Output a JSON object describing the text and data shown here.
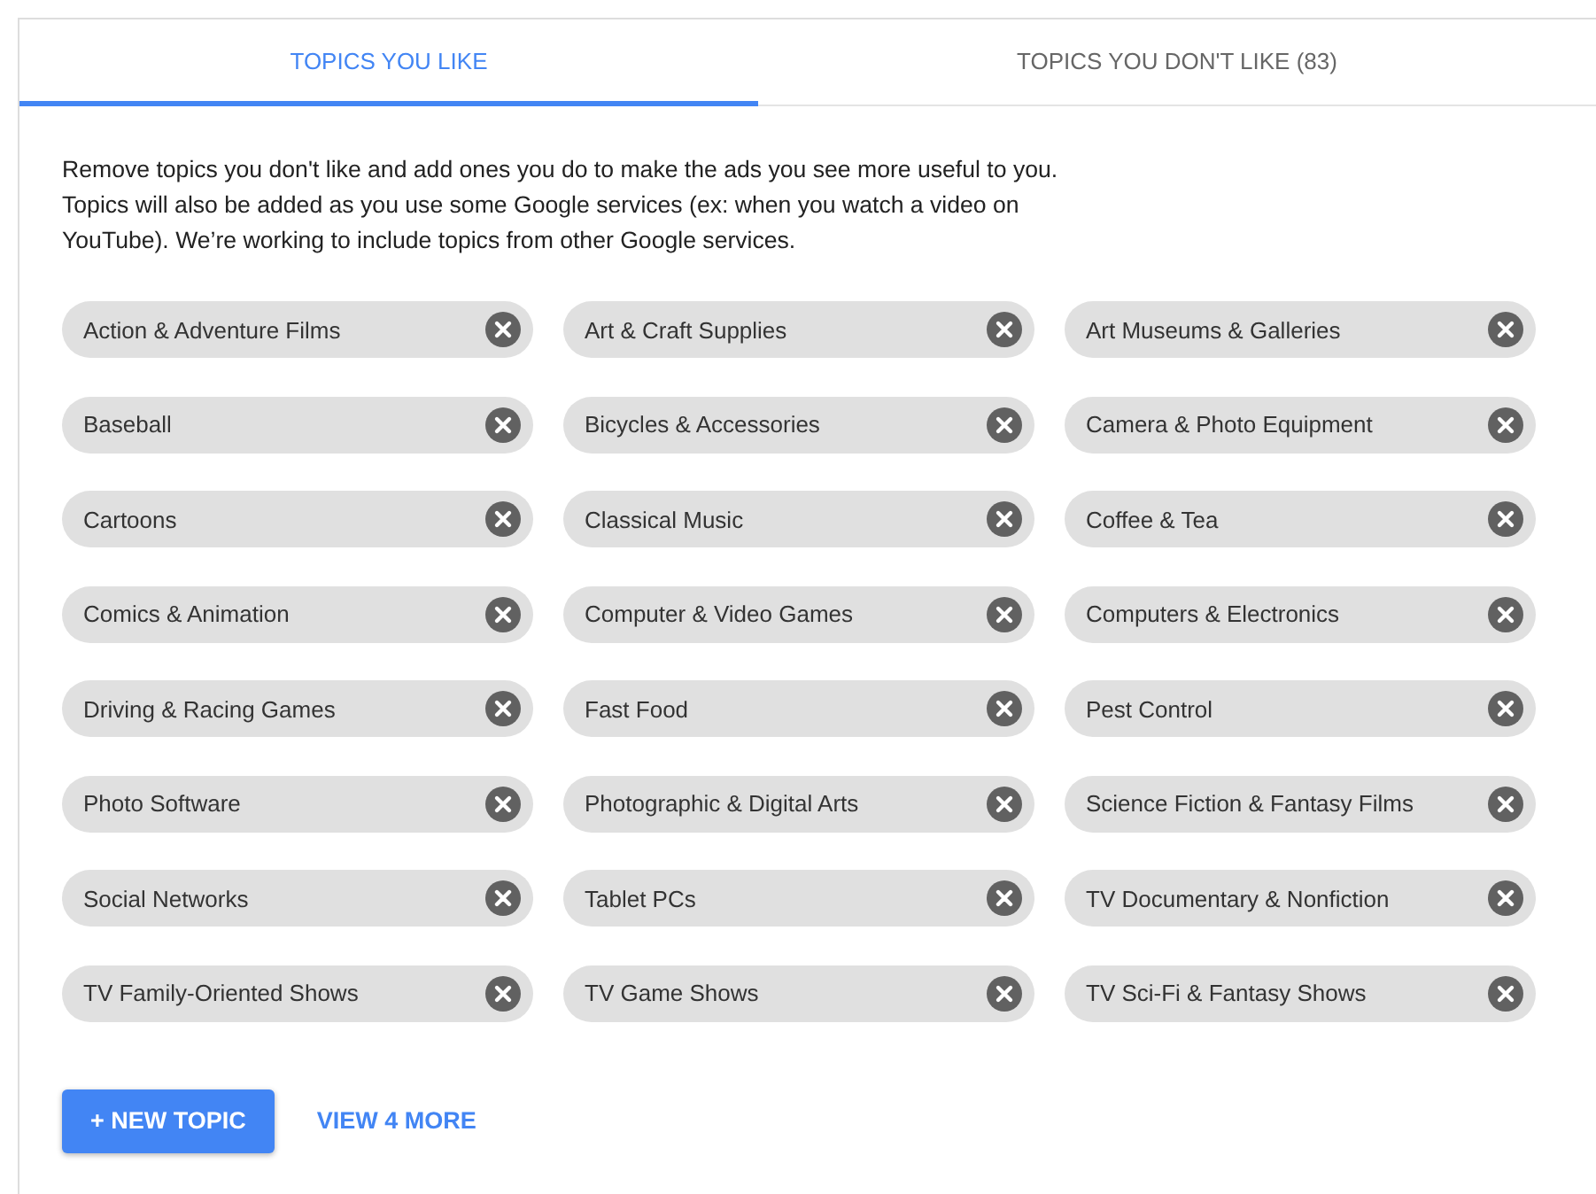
{
  "tabs": [
    {
      "label": "TOPICS YOU LIKE",
      "selected": true
    },
    {
      "label": "TOPICS YOU DON'T LIKE (83)",
      "selected": false
    }
  ],
  "description": "Remove topics you don't like and add ones you do to make the ads you see more useful to you. Topics will also be added as you use some Google services (ex: when you watch a video on YouTube). We’re working to include topics from other Google services.",
  "topics": [
    "Action & Adventure Films",
    "Art & Craft Supplies",
    "Art Museums & Galleries",
    "Baseball",
    "Bicycles & Accessories",
    "Camera & Photo Equipment",
    "Cartoons",
    "Classical Music",
    "Coffee & Tea",
    "Comics & Animation",
    "Computer & Video Games",
    "Computers & Electronics",
    "Driving & Racing Games",
    "Fast Food",
    "Pest Control",
    "Photo Software",
    "Photographic & Digital Arts",
    "Science Fiction & Fantasy Films",
    "Social Networks",
    "Tablet PCs",
    "TV Documentary & Nonfiction",
    "TV Family-Oriented Shows",
    "TV Game Shows",
    "TV Sci-Fi & Fantasy Shows"
  ],
  "new_topic_button": "+ NEW TOPIC",
  "view_more_link": "VIEW 4 MORE"
}
